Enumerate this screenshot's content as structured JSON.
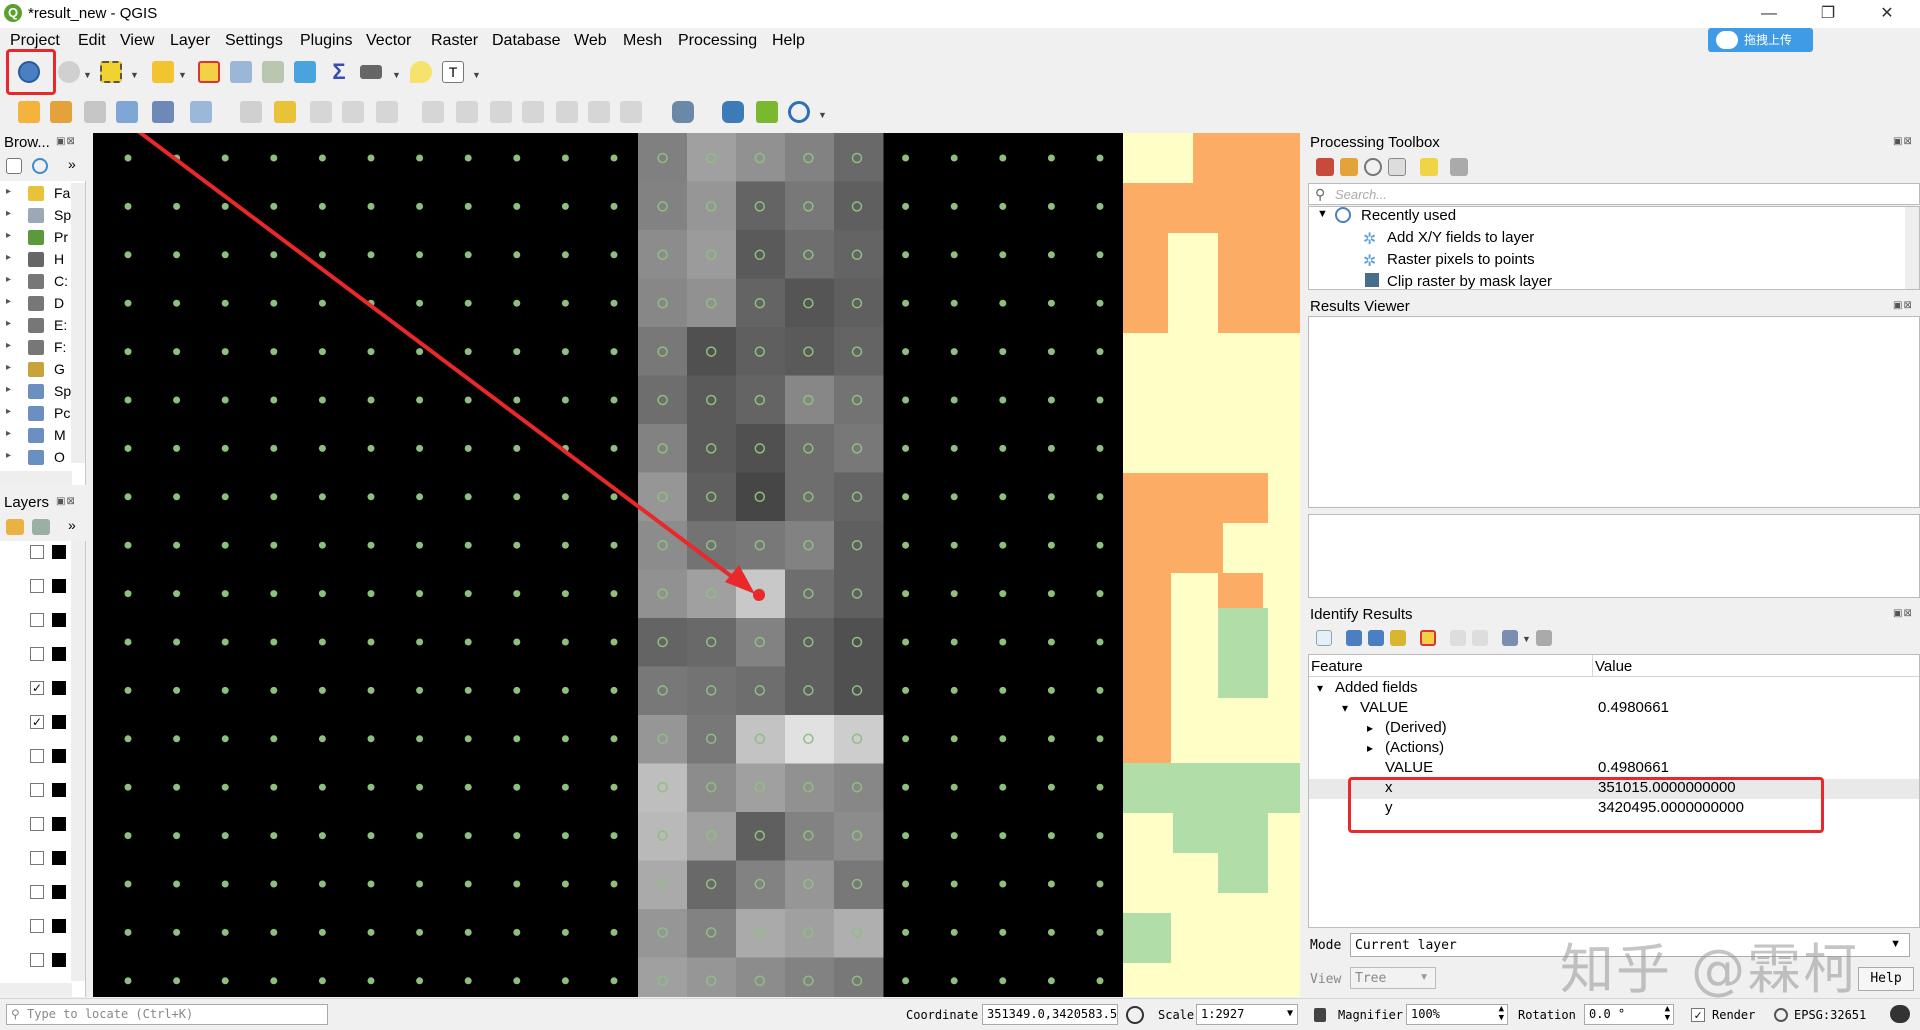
{
  "window": {
    "title": "*result_new - QGIS",
    "logo_letter": "Q",
    "upload_label": "拖拽上传",
    "minimize": "—",
    "restore": "❐",
    "close": "✕"
  },
  "menu": [
    "Project",
    "Edit",
    "View",
    "Layer",
    "Settings",
    "Plugins",
    "Vector",
    "Raster",
    "Database",
    "Web",
    "Mesh",
    "Processing",
    "Help"
  ],
  "browser": {
    "title": "Brow...",
    "controls": "▣⊠",
    "more": "»",
    "items": [
      {
        "icon": "star-icon",
        "label": "Fa"
      },
      {
        "icon": "spatial-bookmarks-icon",
        "label": "Sp"
      },
      {
        "icon": "project-home-icon",
        "label": "Pr"
      },
      {
        "icon": "home-icon",
        "label": "H"
      },
      {
        "icon": "drive-icon",
        "label": "C:"
      },
      {
        "icon": "drive-icon",
        "label": "D"
      },
      {
        "icon": "drive-icon",
        "label": "E:"
      },
      {
        "icon": "drive-icon",
        "label": "F:"
      },
      {
        "icon": "geopackage-icon",
        "label": "G"
      },
      {
        "icon": "spatialite-icon",
        "label": "Sp"
      },
      {
        "icon": "postgis-icon",
        "label": "Pc"
      },
      {
        "icon": "mssql-icon",
        "label": "M"
      },
      {
        "icon": "oracle-icon",
        "label": "O"
      }
    ]
  },
  "layers": {
    "title": "Layers",
    "controls": "▣⊠",
    "more": "»",
    "checked": [
      false,
      false,
      false,
      false,
      true,
      true,
      false,
      false,
      false,
      false,
      false,
      false,
      false
    ]
  },
  "processing": {
    "title": "Processing Toolbox",
    "search_placeholder": "Search...",
    "group": "Recently used",
    "items": [
      "Add X/Y fields to layer",
      "Raster pixels to points",
      "Clip raster by mask layer"
    ]
  },
  "results_viewer": {
    "title": "Results Viewer"
  },
  "identify": {
    "title": "Identify Results",
    "col_feature": "Feature",
    "col_value": "Value",
    "rows": [
      {
        "indent": 0,
        "arrow": "▾",
        "feature": "Added fields",
        "value": ""
      },
      {
        "indent": 1,
        "arrow": "▾",
        "feature": "VALUE",
        "value": "0.4980661"
      },
      {
        "indent": 2,
        "arrow": "▸",
        "feature": "(Derived)",
        "value": ""
      },
      {
        "indent": 2,
        "arrow": "▸",
        "feature": "(Actions)",
        "value": ""
      },
      {
        "indent": 2,
        "arrow": "",
        "feature": "VALUE",
        "value": "0.4980661"
      },
      {
        "indent": 2,
        "arrow": "",
        "feature": "x",
        "value": "351015.0000000000"
      },
      {
        "indent": 2,
        "arrow": "",
        "feature": "y",
        "value": "3420495.0000000000"
      }
    ],
    "mode_label": "Mode",
    "mode_value": "Current layer",
    "view_label": "View",
    "view_value": "Tree",
    "help_label": "Help"
  },
  "statusbar": {
    "locate_placeholder": "Type to locate (Ctrl+K)",
    "coordinate_label": "Coordinate",
    "coordinate_value": "351349.0,3420583.5",
    "scale_label": "Scale",
    "scale_value": "1:2927",
    "magnifier_label": "Magnifier",
    "magnifier_value": "100%",
    "rotation_label": "Rotation",
    "rotation_value": "0.0 °",
    "render_label": "Render",
    "render_checked": true,
    "crs_label": "EPSG:32651",
    "messages_icon": "speech-bubble-icon"
  },
  "watermark": "知乎 @霖柯",
  "colors": {
    "accent": "#3f9be6",
    "annotation_red": "#e8282a",
    "point_green": "#8fbf7f",
    "orange": "#fcac64",
    "cream": "#fffec6",
    "light_green": "#b1dea8"
  }
}
